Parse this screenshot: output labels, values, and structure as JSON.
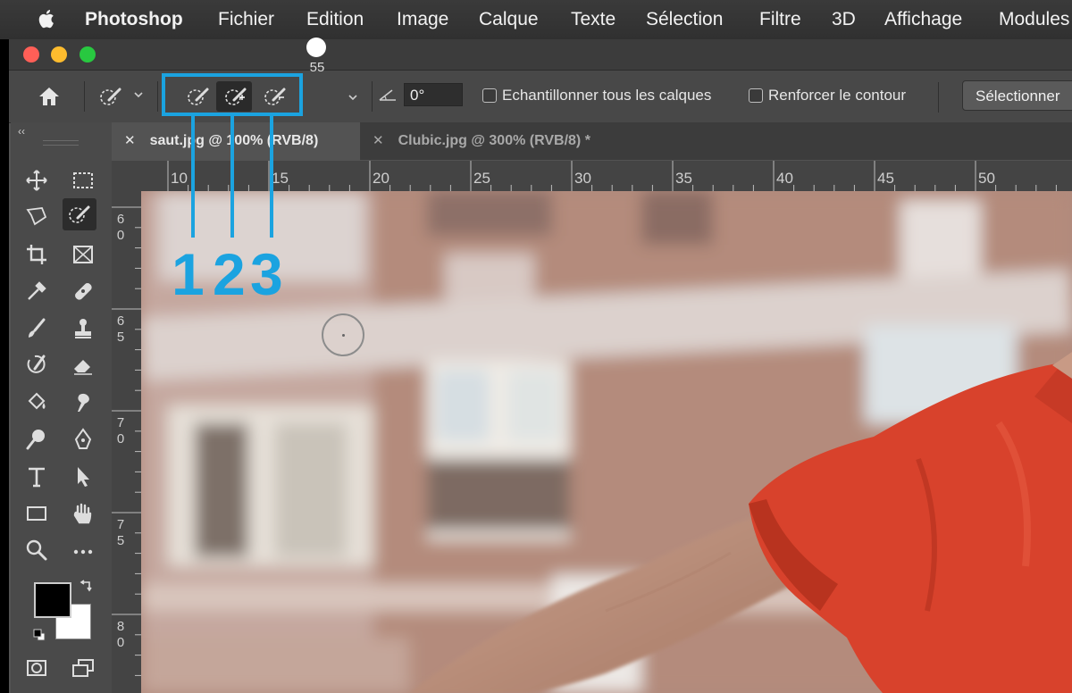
{
  "menubar": {
    "app_name": "Photoshop",
    "items": [
      "Fichier",
      "Edition",
      "Image",
      "Calque",
      "Texte",
      "Sélection",
      "Filtre",
      "3D",
      "Affichage",
      "Modules"
    ]
  },
  "window_controls": {
    "close_color": "#ff5f57",
    "minimize_color": "#febc2e",
    "zoom_color": "#28c840"
  },
  "options_bar": {
    "brush_size": "55",
    "angle_value": "0°",
    "sample_all_layers": {
      "label": "Echantillonner tous les calques",
      "checked": false
    },
    "enhance_edge": {
      "label": "Renforcer le contour",
      "checked": false
    },
    "select_subject_label": "Sélectionner",
    "selection_modes": [
      "new-selection",
      "add-to-selection",
      "subtract-from-selection"
    ],
    "active_mode": "add-to-selection"
  },
  "document_tabs": [
    {
      "label": "saut.jpg @ 100% (RVB/8)",
      "active": true
    },
    {
      "label": "Clubic.jpg @ 300% (RVB/8) *",
      "active": false
    }
  ],
  "rulers": {
    "horizontal_labels": [
      "10",
      "15",
      "20",
      "25",
      "30",
      "35",
      "40",
      "45",
      "50"
    ],
    "vertical_labels": [
      [
        "6",
        "0"
      ],
      [
        "6",
        "5"
      ],
      [
        "7",
        "0"
      ],
      [
        "7",
        "5"
      ],
      [
        "8",
        "0"
      ]
    ]
  },
  "annotation": {
    "color": "#1ba3e0",
    "numbers": [
      "1",
      "2",
      "3"
    ]
  },
  "colors": {
    "foreground": "#000000",
    "background": "#ffffff",
    "shirt": "#d8422c"
  }
}
